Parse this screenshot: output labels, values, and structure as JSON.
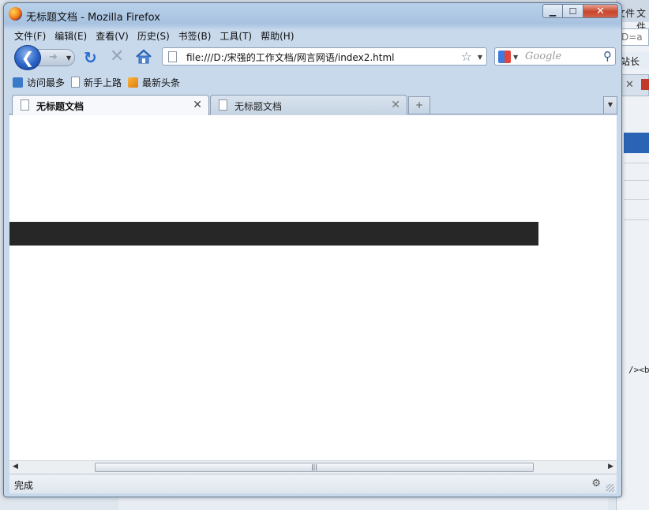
{
  "window": {
    "title": "无标题文档 - Mozilla Firefox"
  },
  "menu": [
    "文件(F)",
    "编辑(E)",
    "查看(V)",
    "历史(S)",
    "书签(B)",
    "工具(T)",
    "帮助(H)"
  ],
  "nav": {
    "url": "file:///D:/宋强的工作文档/网言网语/index2.html",
    "search_placeholder": "Google"
  },
  "bookmarks": [
    "访问最多",
    "新手上路",
    "最新头条"
  ],
  "tabs": [
    {
      "title": "无标题文档",
      "active": true
    },
    {
      "title": "无标题文档",
      "active": false
    }
  ],
  "page": {
    "bar_color": "#272727"
  },
  "status": {
    "text": "完成"
  },
  "background": {
    "text1": "文件",
    "text2": "文件",
    "url_fragment": "D=a",
    "row_label": "站长",
    "code_fragment": "/><b"
  }
}
